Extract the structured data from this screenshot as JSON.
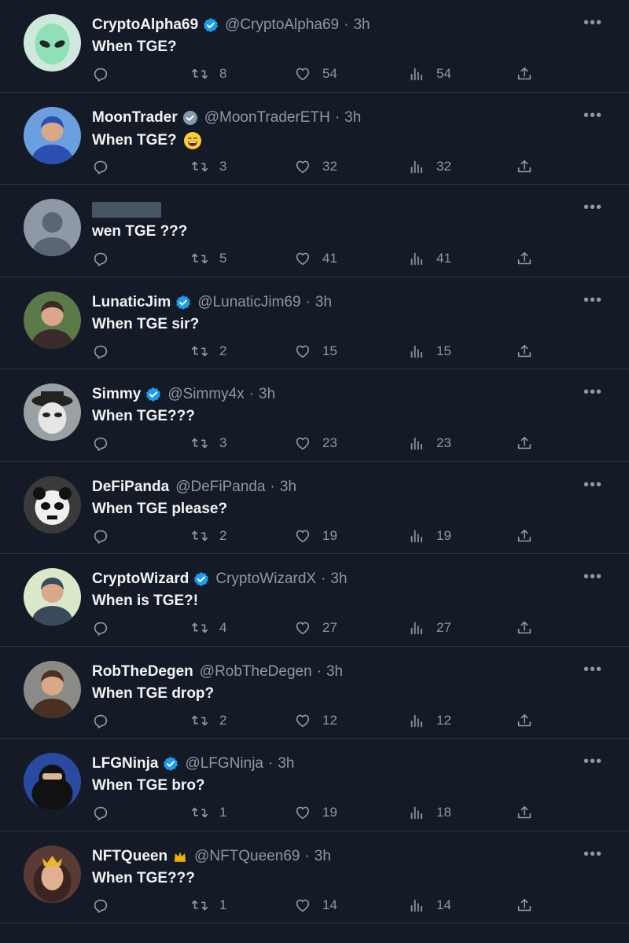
{
  "feed": {
    "replies": [
      {
        "name": "CryptoAlpha69",
        "badge": "verified",
        "handle": "@CryptoAlpha69",
        "sep": "·",
        "time": "3h",
        "text": "When TGE?",
        "emoji": null,
        "counts": {
          "retweets": "8",
          "likes": "54",
          "views": "54"
        },
        "avatar": {
          "bg": "#2a3a33",
          "fg": "#8fe0b8",
          "kind": "alien"
        }
      },
      {
        "name": "MoonTrader",
        "badge": "gray-verified",
        "handle": "@MoonTraderETH",
        "sep": "·",
        "time": "3h",
        "text": "When TGE?",
        "emoji": "grinning-face",
        "counts": {
          "retweets": "3",
          "likes": "32",
          "views": "32"
        },
        "avatar": {
          "bg": "#6aa0e0",
          "fg": "#2d4fb0",
          "kind": "person"
        }
      },
      {
        "name": "",
        "badge": "none",
        "handle": "",
        "sep": "",
        "time": "",
        "text": "wen TGE ???",
        "emoji": null,
        "redacted": true,
        "counts": {
          "retweets": "5",
          "likes": "41",
          "views": "41"
        },
        "avatar": {
          "bg": "#8e98a6",
          "fg": "#5a6674",
          "kind": "default"
        }
      },
      {
        "name": "LunaticJim",
        "badge": "verified",
        "handle": "@LunaticJim69",
        "sep": "·",
        "time": "3h",
        "text": "When TGE sir?",
        "emoji": null,
        "counts": {
          "retweets": "2",
          "likes": "15",
          "views": "15"
        },
        "avatar": {
          "bg": "#5b7a4a",
          "fg": "#3a2a2a",
          "kind": "person"
        }
      },
      {
        "name": "Simmy",
        "badge": "verified",
        "handle": "@Simmy4x",
        "sep": "·",
        "time": "3h",
        "text": "When TGE???",
        "emoji": null,
        "counts": {
          "retweets": "3",
          "likes": "23",
          "views": "23"
        },
        "avatar": {
          "bg": "#9aa0a4",
          "fg": "#e6e6e6",
          "kind": "mask"
        }
      },
      {
        "name": "DeFiPanda",
        "badge": "none",
        "handle": "@DeFiPanda",
        "sep": "·",
        "time": "3h",
        "text": "When TGE please?",
        "emoji": null,
        "counts": {
          "retweets": "2",
          "likes": "19",
          "views": "19"
        },
        "avatar": {
          "bg": "#3a3a3a",
          "fg": "#f0f0f0",
          "kind": "panda"
        }
      },
      {
        "name": "CryptoWizard",
        "badge": "verified",
        "handle": "CryptoWizardX",
        "sep": "·",
        "time": "3h",
        "text": "When is TGE?!",
        "emoji": null,
        "counts": {
          "retweets": "4",
          "likes": "27",
          "views": "27"
        },
        "avatar": {
          "bg": "#d8e8c8",
          "fg": "#3a4a5a",
          "kind": "person"
        }
      },
      {
        "name": "RobTheDegen",
        "badge": "none",
        "handle": "@RobTheDegen",
        "sep": "·",
        "time": "3h",
        "text": "When TGE drop?",
        "emoji": null,
        "counts": {
          "retweets": "2",
          "likes": "12",
          "views": "12"
        },
        "avatar": {
          "bg": "#8a8a86",
          "fg": "#4a3020",
          "kind": "person"
        }
      },
      {
        "name": "LFGNinja",
        "badge": "verified",
        "handle": "@LFGNinja",
        "sep": "·",
        "time": "3h",
        "text": "When TGE bro?",
        "emoji": null,
        "counts": {
          "retweets": "1",
          "likes": "19",
          "views": "18"
        },
        "avatar": {
          "bg": "#2a4aa0",
          "fg": "#111111",
          "kind": "ninja"
        }
      },
      {
        "name": "NFTQueen",
        "badge": "crown",
        "handle": "@NFTQueen69",
        "sep": "·",
        "time": "3h",
        "text": "When TGE???",
        "emoji": null,
        "counts": {
          "retweets": "1",
          "likes": "14",
          "views": "14"
        },
        "avatar": {
          "bg": "#5a3a34",
          "fg": "#e0b090",
          "kind": "queen"
        }
      }
    ]
  },
  "icons": {
    "reply": "reply-icon",
    "retweet": "retweet-icon",
    "like": "like-icon",
    "views": "views-icon",
    "share": "share-icon",
    "more": "more-icon"
  },
  "colors": {
    "background": "#151b26",
    "text": "#e7e9ea",
    "muted": "#8b98a5",
    "divider": "#2c3440",
    "verified": "#1d9bf0"
  },
  "more_label": "•••"
}
